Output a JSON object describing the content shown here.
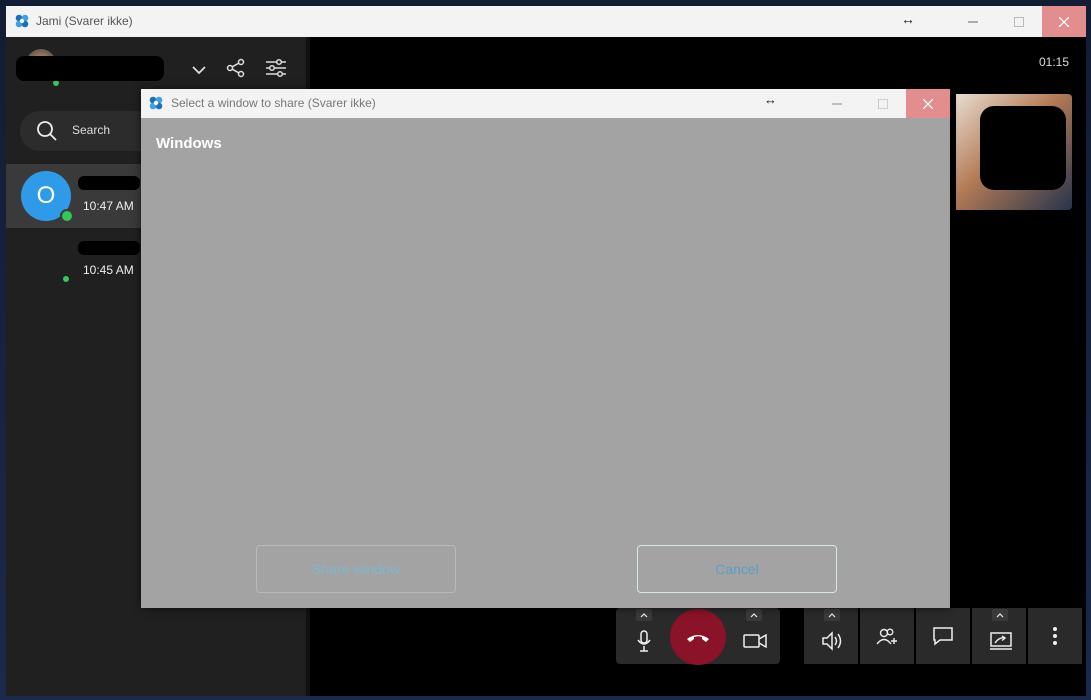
{
  "main_window": {
    "title": "Jami (Svarer ikke)"
  },
  "sidebar": {
    "search": {
      "label": "Search"
    },
    "conversations": [
      {
        "avatar_letter": "O",
        "time": "10:47 AM"
      },
      {
        "time": "10:45 AM"
      }
    ]
  },
  "call": {
    "timer": "01:15"
  },
  "dialog": {
    "title": "Select a window to share (Svarer ikke)",
    "heading": "Windows",
    "share_button": "Share window",
    "cancel_button": "Cancel"
  },
  "colors": {
    "hangup": "#8a1229",
    "avatar": "#2f9be8",
    "presence": "#35c759",
    "close_button": "#e38e8e"
  }
}
